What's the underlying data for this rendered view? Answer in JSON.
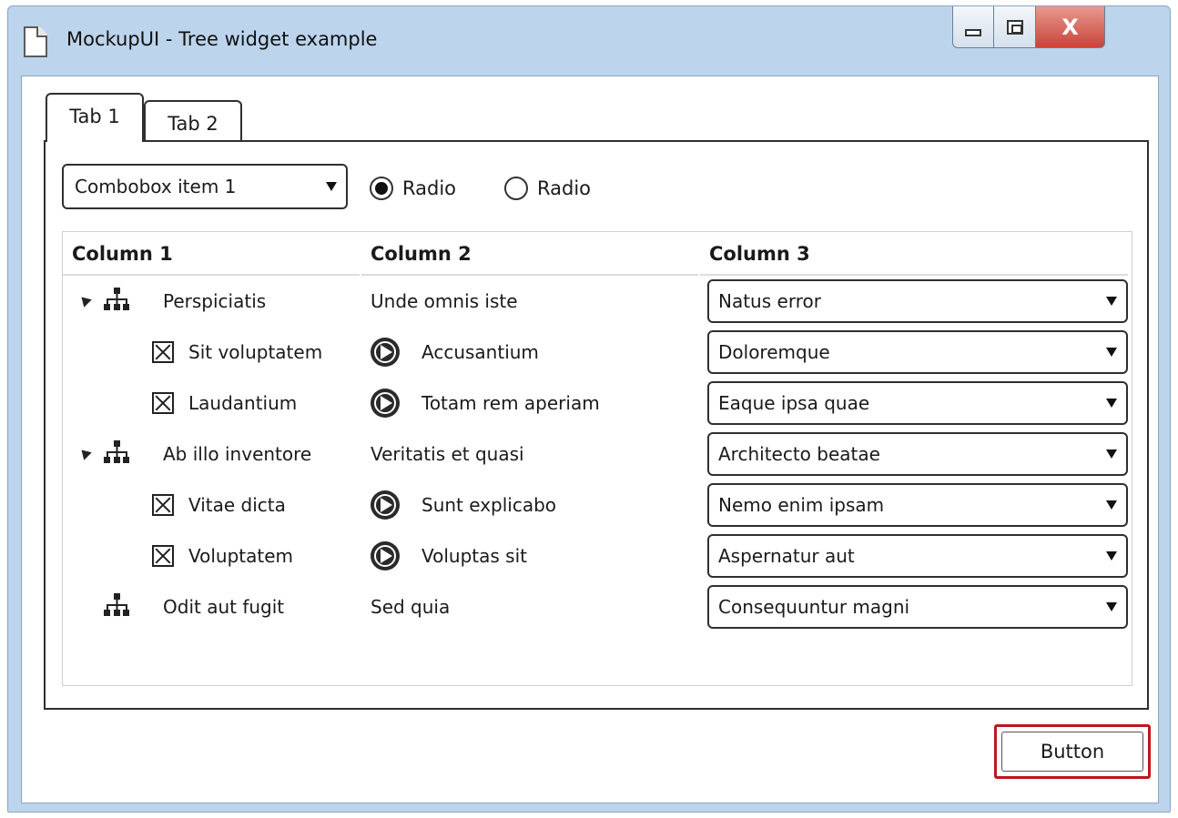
{
  "window": {
    "title": "MockupUI - Tree widget example"
  },
  "tabs": [
    {
      "label": "Tab 1",
      "selected": true
    },
    {
      "label": "Tab 2",
      "selected": false
    }
  ],
  "combobox": {
    "value": "Combobox item 1"
  },
  "radios": [
    {
      "label": "Radio",
      "checked": true
    },
    {
      "label": "Radio",
      "checked": false
    }
  ],
  "tree": {
    "columns": [
      "Column 1",
      "Column 2",
      "Column 3"
    ],
    "rows": [
      {
        "col1": "Perspiciatis",
        "col2": "Unde omnis iste",
        "col3": "Natus error",
        "icon": "org-chart-icon",
        "expander": true,
        "level": 0
      },
      {
        "col1": "Sit voluptatem",
        "col2": "Accusantium",
        "col3": "Doloremque",
        "icon": "checkbox-checked-icon",
        "col2_icon": "play-circle-icon",
        "level": 1
      },
      {
        "col1": "Laudantium",
        "col2": "Totam rem aperiam",
        "col3": "Eaque ipsa quae",
        "icon": "checkbox-checked-icon",
        "col2_icon": "play-circle-icon",
        "level": 1
      },
      {
        "col1": "Ab illo inventore",
        "col2": "Veritatis et quasi",
        "col3": "Architecto beatae",
        "icon": "org-chart-icon",
        "expander": true,
        "level": 0
      },
      {
        "col1": "Vitae dicta",
        "col2": "Sunt explicabo",
        "col3": "Nemo enim ipsam",
        "icon": "checkbox-checked-icon",
        "col2_icon": "play-circle-icon",
        "level": 1
      },
      {
        "col1": "Voluptatem",
        "col2": "Voluptas sit",
        "col3": "Aspernatur aut",
        "icon": "checkbox-checked-icon",
        "col2_icon": "play-circle-icon",
        "level": 1
      },
      {
        "col1": "Odit aut fugit",
        "col2": "Sed quia",
        "col3": "Consequuntur magni",
        "icon": "org-chart-icon",
        "expander": false,
        "level": 0
      }
    ]
  },
  "footer": {
    "button_label": "Button"
  },
  "colors": {
    "titlebar": "#bcd4ec",
    "close_button": "#c8443a",
    "focus_border": "#c0151c"
  }
}
